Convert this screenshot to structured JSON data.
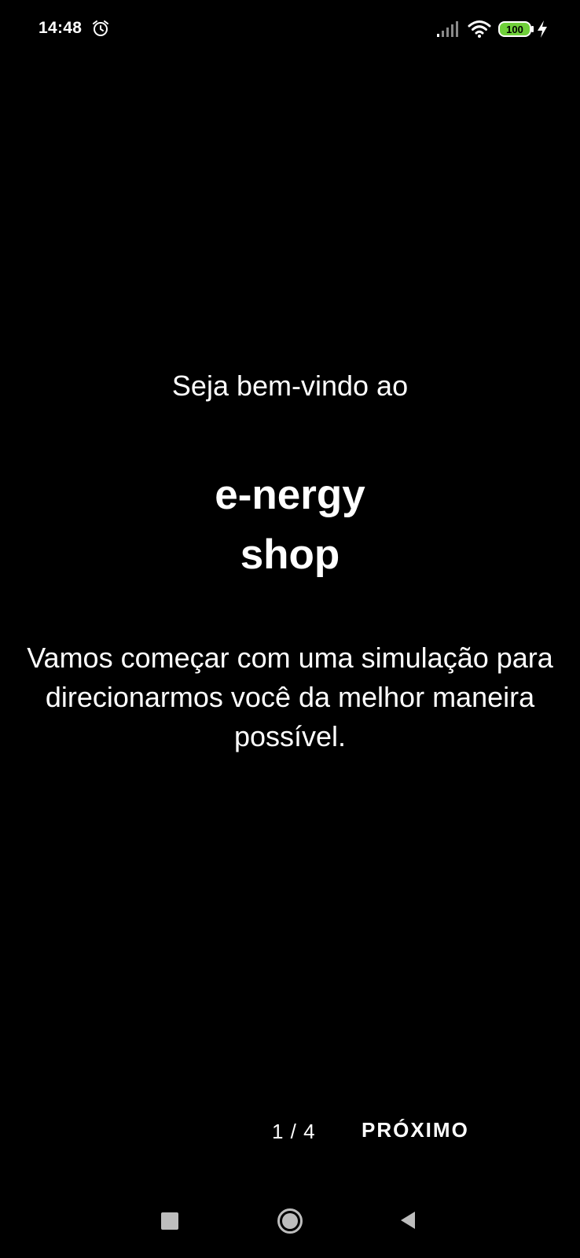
{
  "status_bar": {
    "time": "14:48",
    "battery_level": "100",
    "icons": [
      "alarm-icon",
      "signal-icon",
      "wifi-icon",
      "battery-icon",
      "charging-icon"
    ],
    "battery_color": "#6fcf3a"
  },
  "onboarding": {
    "welcome": "Seja bem-vindo ao",
    "brand_line1": "e-nergy",
    "brand_line2": "shop",
    "description": "Vamos começar com uma simulação para direcionarmos você da melhor maneira possível.",
    "page_indicator": "1 / 4",
    "next_label": "PRÓXIMO"
  },
  "nav_bar": {
    "icons": [
      "recent-apps-icon",
      "home-icon",
      "back-icon"
    ]
  },
  "colors": {
    "background": "#000000",
    "text": "#ffffff"
  }
}
